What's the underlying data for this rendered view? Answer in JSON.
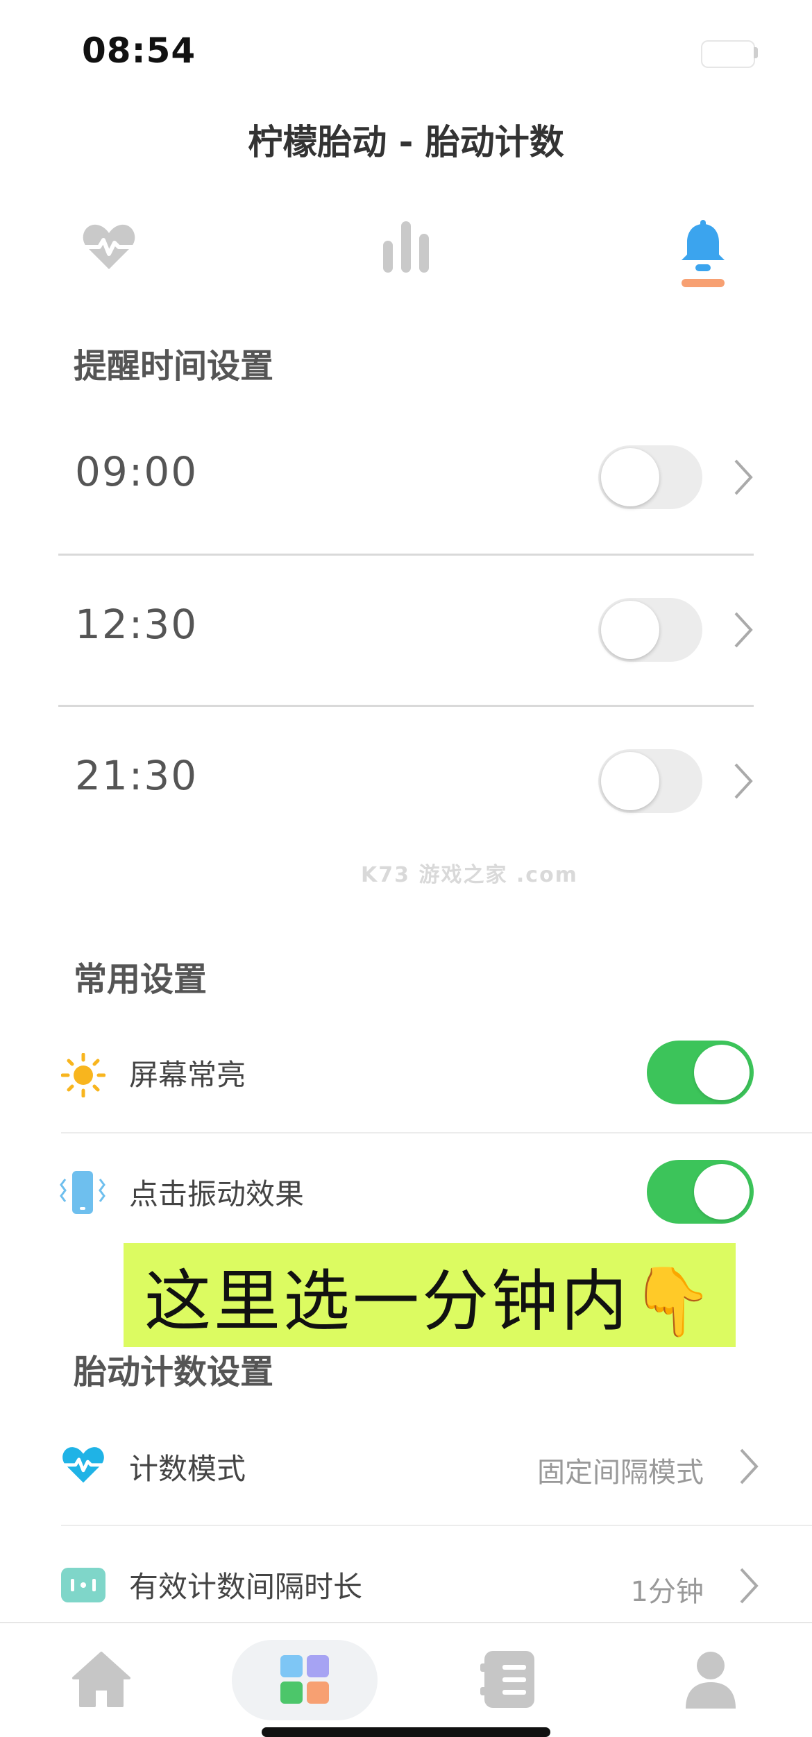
{
  "status_bar": {
    "time": "08:54"
  },
  "header": {
    "title": "柠檬胎动 - 胎动计数"
  },
  "tabs": [
    {
      "name": "heart-tab",
      "icon": "heart-pulse-icon",
      "active": false
    },
    {
      "name": "stats-tab",
      "icon": "bar-chart-icon",
      "active": false
    },
    {
      "name": "reminder-tab",
      "icon": "bell-icon",
      "active": true
    }
  ],
  "reminder_section": {
    "title": "提醒时间设置",
    "items": [
      {
        "time": "09:00",
        "enabled": false
      },
      {
        "time": "12:30",
        "enabled": false
      },
      {
        "time": "21:30",
        "enabled": false
      }
    ]
  },
  "watermark": "K73 游戏之家 .com",
  "common_section": {
    "title": "常用设置",
    "items": [
      {
        "label": "屏幕常亮",
        "icon": "sun-icon",
        "enabled": true
      },
      {
        "label": "点击振动效果",
        "icon": "phone-vibrate-icon",
        "enabled": true
      }
    ]
  },
  "annotation": {
    "text": "这里选一分钟内👇"
  },
  "fetal_section": {
    "title": "胎动计数设置",
    "items": [
      {
        "label": "计数模式",
        "value": "固定间隔模式",
        "icon": "heart-pulse-icon"
      },
      {
        "label": "有效计数间隔时长",
        "value": "1分钟",
        "icon": "interval-icon"
      }
    ]
  },
  "bottom_nav": [
    {
      "name": "home",
      "icon": "home-icon",
      "active": false
    },
    {
      "name": "tools",
      "icon": "grid-icon",
      "active": true
    },
    {
      "name": "records",
      "icon": "list-icon",
      "active": false
    },
    {
      "name": "profile",
      "icon": "user-icon",
      "active": false
    }
  ],
  "colors": {
    "accent_blue": "#3ba4ee",
    "toggle_on": "#3cc45a",
    "tab_underline": "#f7a072",
    "overlay_bg": "#dcfb61"
  }
}
